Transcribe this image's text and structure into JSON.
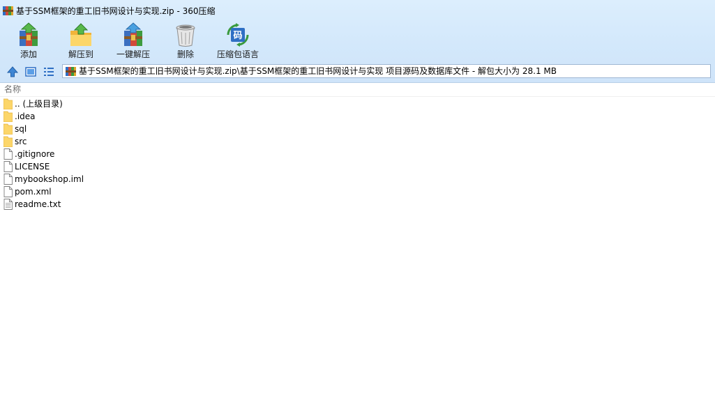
{
  "window": {
    "title": "基于SSM框架的重工旧书网设计与实现.zip - 360压缩",
    "app_icon": "archive-icon"
  },
  "toolbar": {
    "add_label": "添加",
    "extract_to_label": "解压到",
    "one_click_extract_label": "一键解压",
    "delete_label": "删除",
    "archive_language_label": "压缩包语言",
    "language_icon_glyph": "码"
  },
  "nav": {
    "up_icon": "up-arrow-icon",
    "view_thumbnail_icon": "thumbnail-view-icon",
    "view_list_icon": "list-view-icon",
    "address_text": "基于SSM框架的重工旧书网设计与实现.zip\\基于SSM框架的重工旧书网设计与实现 项目源码及数据库文件 - 解包大小为 28.1 MB"
  },
  "list": {
    "column_name": "名称",
    "items": [
      {
        "name": ".. (上级目录)",
        "type": "folder"
      },
      {
        "name": ".idea",
        "type": "folder"
      },
      {
        "name": "sql",
        "type": "folder"
      },
      {
        "name": "src",
        "type": "folder"
      },
      {
        "name": ".gitignore",
        "type": "file"
      },
      {
        "name": "LICENSE",
        "type": "file"
      },
      {
        "name": "mybookshop.iml",
        "type": "file"
      },
      {
        "name": "pom.xml",
        "type": "file"
      },
      {
        "name": "readme.txt",
        "type": "text-file"
      }
    ]
  },
  "colors": {
    "chrome_top": "#dceefd",
    "chrome_bottom": "#cfe4f9",
    "folder_yellow": "#fcd66a",
    "header_text": "#6d6d6d"
  }
}
